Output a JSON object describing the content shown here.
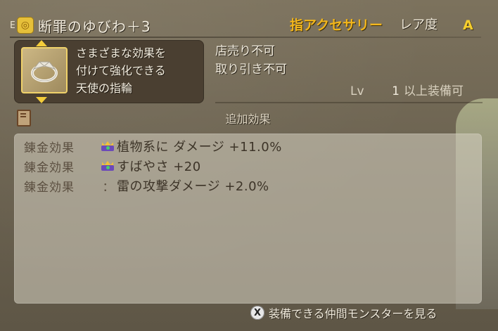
{
  "item": {
    "equipped_marker": "E",
    "name": "断罪のゆびわ＋3",
    "category": "指アクセサリー",
    "rarity_label": "レア度",
    "rarity_value": "A",
    "icon": "ring-icon"
  },
  "description": {
    "lines": [
      "さまざまな効果を",
      "付けて強化できる",
      "天使の指輪"
    ]
  },
  "trade": {
    "sell": "店売り不可",
    "trade": "取り引き不可"
  },
  "level": {
    "label": "Lv",
    "value": "1",
    "suffix": "以上装備可"
  },
  "effects": {
    "title": "追加効果",
    "rows": [
      {
        "label": "錬金効果",
        "marker": "crown-icon",
        "text": "植物系に ダメージ +11.0%"
      },
      {
        "label": "錬金効果",
        "marker": "crown-icon",
        "text": "すばやさ +20"
      },
      {
        "label": "錬金効果",
        "marker": "：",
        "text": "雷の攻撃ダメージ +2.0%"
      }
    ]
  },
  "footer": {
    "button": "X",
    "text": "装備できる仲間モンスターを見る"
  }
}
